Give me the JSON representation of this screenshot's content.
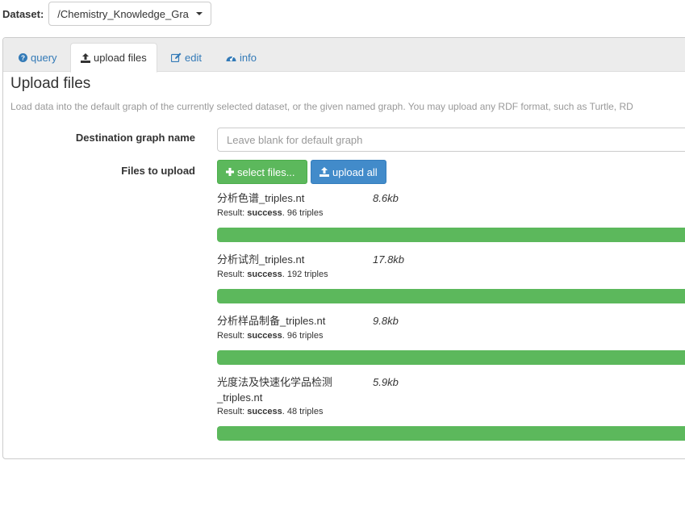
{
  "dataset": {
    "label": "Dataset:",
    "selected": "/Chemistry_Knowledge_Gra"
  },
  "tabs": [
    {
      "label": "query",
      "icon": "question-circle-icon"
    },
    {
      "label": "upload files",
      "icon": "upload-icon"
    },
    {
      "label": "edit",
      "icon": "edit-icon"
    },
    {
      "label": "info",
      "icon": "dashboard-icon"
    }
  ],
  "upload": {
    "title": "Upload files",
    "description": "Load data into the default graph of the currently selected dataset, or the given named graph. You may upload any RDF format, such as Turtle, RD",
    "dest_label": "Destination graph name",
    "dest_placeholder": "Leave blank for default graph",
    "dest_value": "",
    "files_label": "Files to upload",
    "select_button": "select files...",
    "upload_all_button": "upload all",
    "files": [
      {
        "name": "分析色谱_triples.nt",
        "size": "8.6kb",
        "result_prefix": "Result: ",
        "status": "success",
        "detail": ". 96 triples",
        "progress": 1.0
      },
      {
        "name": "分析试剂_triples.nt",
        "size": "17.8kb",
        "result_prefix": "Result: ",
        "status": "success",
        "detail": ". 192 triples",
        "progress": 1.0
      },
      {
        "name": "分析样品制备_triples.nt",
        "size": "9.8kb",
        "result_prefix": "Result: ",
        "status": "success",
        "detail": ". 96 triples",
        "progress": 1.0
      },
      {
        "name": "光度法及快速化学品检测_triples.nt",
        "size": "5.9kb",
        "result_prefix": "Result: ",
        "status": "success",
        "detail": ". 48 triples",
        "progress": 1.0
      }
    ]
  },
  "colors": {
    "link": "#337ab7",
    "success": "#5cb85c",
    "primary": "#428bca"
  }
}
